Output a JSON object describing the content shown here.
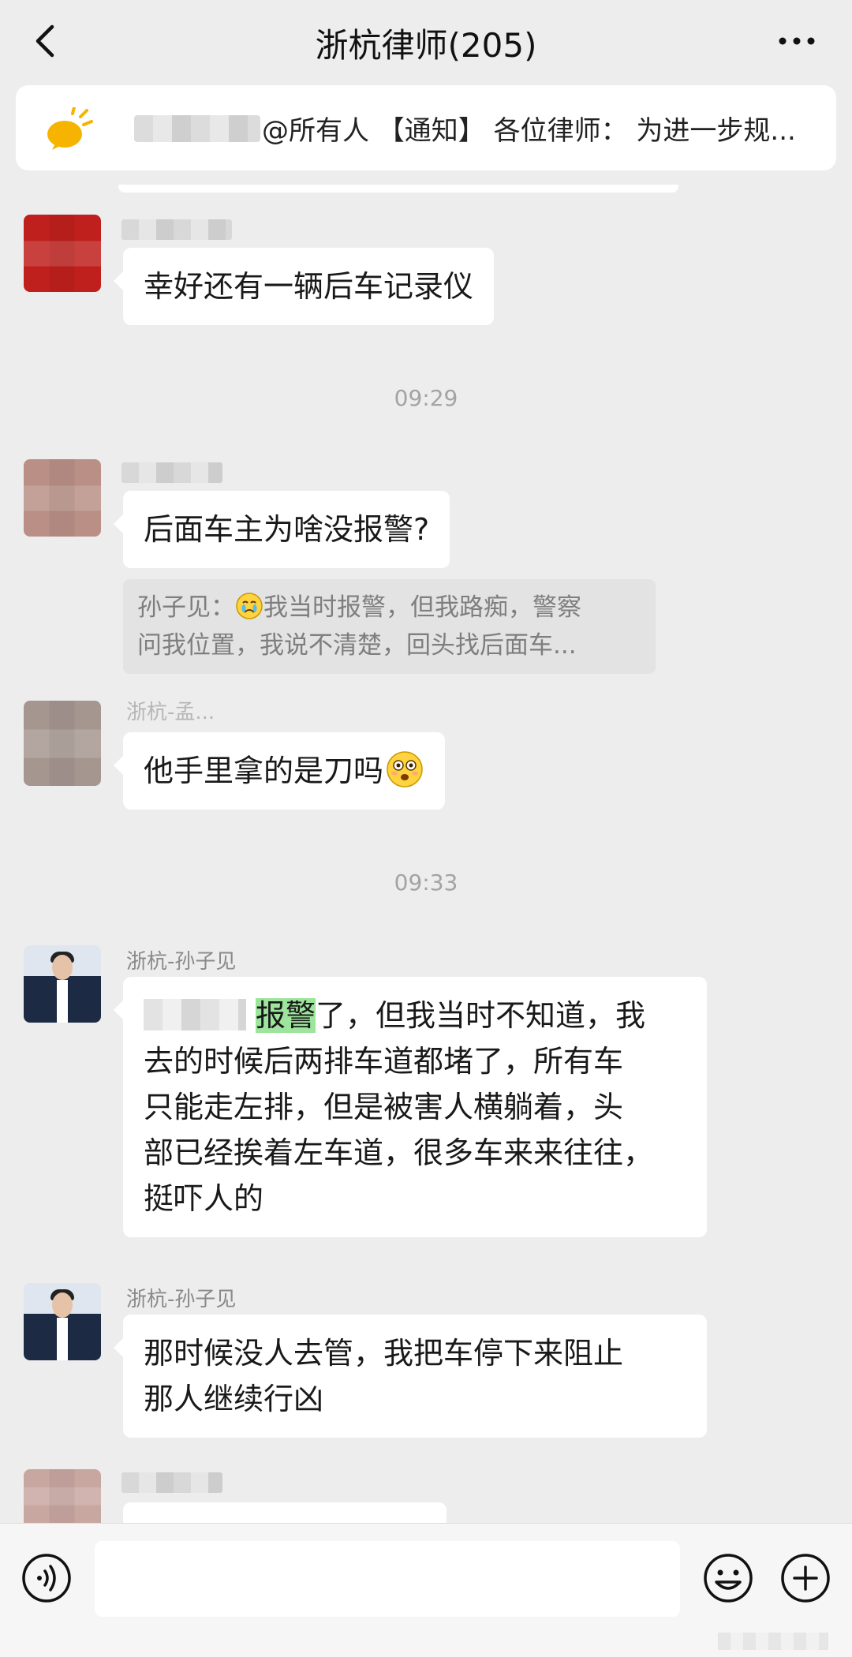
{
  "header": {
    "title": "浙杭律师(205)",
    "back_icon": "chevron-left-icon",
    "more_icon": "more-dots-icon"
  },
  "notice": {
    "icon": "announcement-bulb-icon",
    "text": "@所有人 【通知】 各位律师：  为进一步规..."
  },
  "messages": [
    {
      "text": "幸好还有一辆后车记录仪"
    },
    {
      "time": "09:29"
    },
    {
      "text": "后面车主为啥没报警?",
      "quote": {
        "sender": "孙子见：",
        "line1": "我当时报警，但我路痴，警察",
        "line2": "问我位置，我说不清楚，回头找后面车..."
      }
    },
    {
      "sender": "浙杭-孟...",
      "text": "他手里拿的是刀吗"
    },
    {
      "time": "09:33"
    },
    {
      "sender": "浙杭-孙子见",
      "highlight": "报警",
      "line1": "了，但我当时不知道，我",
      "line2": "去的时候后两排车道都堵了，所有车",
      "line3": "只能走左排，但是被害人横躺着，头",
      "line4": "部已经挨着左车道，很多车来来往往，",
      "line5": "挺吓人的"
    },
    {
      "sender": "浙杭-孙子见",
      "line1": "那时候没人去管，我把车停下来阻止",
      "line2": "那人继续行凶"
    }
  ],
  "input_bar": {
    "voice_icon": "voice-icon",
    "emoji_icon": "emoji-icon",
    "plus_icon": "plus-circle-icon"
  }
}
